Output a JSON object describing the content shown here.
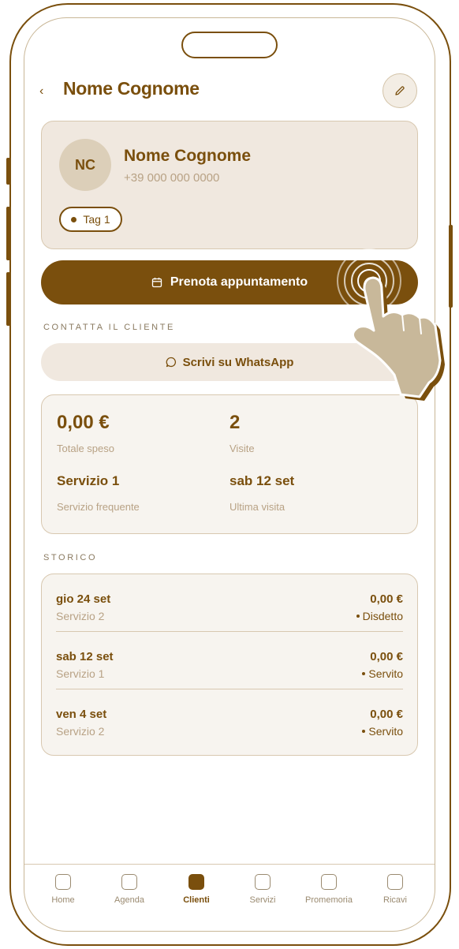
{
  "header": {
    "back_icon": "chevron-left-icon",
    "title": "Nome Cognome",
    "edit_icon": "pencil-icon"
  },
  "profile": {
    "initials": "NC",
    "name": "Nome Cognome",
    "phone": "+39 000 000 0000",
    "tag": "Tag 1"
  },
  "actions": {
    "book_label": "Prenota appuntamento",
    "book_icon": "calendar-icon",
    "contact_section": "CONTATTA IL CLIENTE",
    "whatsapp_label": "Scrivi su WhatsApp",
    "whatsapp_icon": "chat-bubble-icon"
  },
  "stats": {
    "total_spent_value": "0,00 €",
    "total_spent_label": "Totale speso",
    "visits_value": "2",
    "visits_label": "Visite",
    "frequent_service_value": "Servizio 1",
    "frequent_service_label": "Servizio frequente",
    "last_visit_value": "sab 12 set",
    "last_visit_label": "Ultima visita"
  },
  "history": {
    "section_label": "STORICO",
    "rows": [
      {
        "date": "gio 24 set",
        "service": "Servizio 2",
        "amount": "0,00 €",
        "status": "Disdetto"
      },
      {
        "date": "sab 12 set",
        "service": "Servizio 1",
        "amount": "0,00 €",
        "status": "Servito"
      },
      {
        "date": "ven 4 set",
        "service": "Servizio 2",
        "amount": "0,00 €",
        "status": "Servito"
      }
    ]
  },
  "tabbar": {
    "tabs": [
      {
        "label": "Home",
        "active": false
      },
      {
        "label": "Agenda",
        "active": false
      },
      {
        "label": "Clienti",
        "active": true
      },
      {
        "label": "Servizi",
        "active": false
      },
      {
        "label": "Promemoria",
        "active": false
      },
      {
        "label": "Ricavi",
        "active": false
      }
    ]
  },
  "colors": {
    "brand": "#7a4f0d",
    "card_bg": "#f0e8df",
    "muted_text": "#b8a285"
  }
}
